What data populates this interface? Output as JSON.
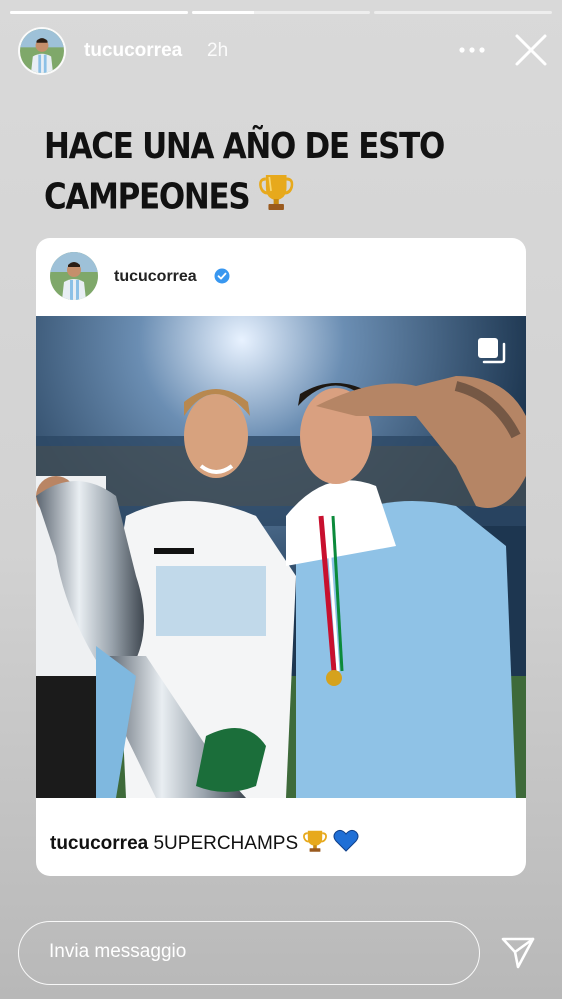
{
  "story": {
    "progress_segments": [
      1.0,
      0.35,
      0.0
    ],
    "username": "tucucorrea",
    "time_ago": "2h",
    "more_icon": "more-horizontal-icon",
    "close_icon": "close-icon"
  },
  "headline": {
    "line1": "HACE UNA AÑO DE ESTO",
    "line2": "CAMPEONES",
    "emoji": "trophy-icon"
  },
  "post": {
    "username": "tucucorrea",
    "verified": true,
    "multi_image_icon": "multiple-images-icon",
    "caption_user": "tucucorrea",
    "caption_text": "5UPERCHAMPS",
    "caption_emojis": [
      "trophy-icon",
      "blue-heart-icon"
    ]
  },
  "reply": {
    "placeholder": "Invia messaggio",
    "send_icon": "send-icon"
  },
  "colors": {
    "white": "#ffffff",
    "verified_blue": "#3897f0",
    "heart_blue": "#1f6fd6",
    "trophy_gold": "#e0a21a"
  }
}
